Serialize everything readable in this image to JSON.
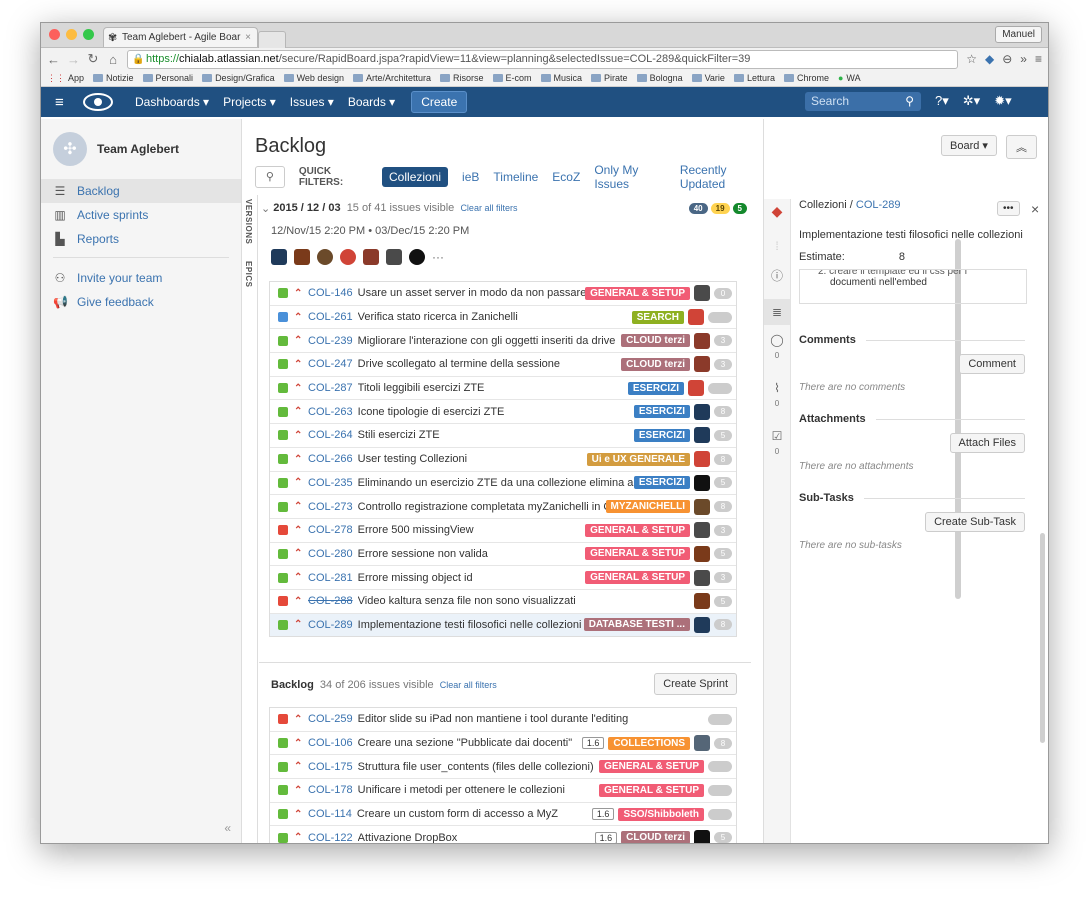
{
  "browser": {
    "tab_title": "Team Aglebert - Agile Boar",
    "user": "Manuel",
    "url_https": "https://",
    "url_host": "chialab.atlassian.net",
    "url_path": "/secure/RapidBoard.jspa?rapidView=11&view=planning&selectedIssue=COL-289&quickFilter=39",
    "bookmarks": [
      "App",
      "Notizie",
      "Personali",
      "Design/Grafica",
      "Web design",
      "Arte/Architettura",
      "Risorse",
      "E-com",
      "Musica",
      "Pirate",
      "Bologna",
      "Varie",
      "Lettura",
      "Chrome",
      "WA"
    ]
  },
  "nav": {
    "menu": [
      "Dashboards ▾",
      "Projects ▾",
      "Issues ▾",
      "Boards ▾"
    ],
    "create": "Create",
    "search_placeholder": "Search"
  },
  "sidebar": {
    "team": "Team Aglebert",
    "items": [
      "Backlog",
      "Active sprints",
      "Reports"
    ],
    "extra": [
      "Invite your team",
      "Give feedback"
    ]
  },
  "page": {
    "title": "Backlog",
    "board_btn": "Board ▾",
    "quick_label": "QUICK FILTERS:",
    "filters": [
      "Collezioni",
      "ieB",
      "Timeline",
      "EcoZ",
      "Only My Issues",
      "Recently Updated"
    ],
    "tab_versions": "VERSIONS",
    "tab_epics": "EPICS"
  },
  "sprint": {
    "name": "2015 / 12 / 03",
    "count": "15 of 41 issues visible",
    "clear": "Clear all filters",
    "badges": [
      "40",
      "19",
      "5"
    ],
    "dates": "12/Nov/15 2:20 PM • 03/Dec/15 2:20 PM",
    "more": "···",
    "issues": [
      {
        "type": "story",
        "key": "COL-146",
        "summary": "Usare un asset server in modo da non passare i co",
        "epic": "GENERAL & SETUP",
        "epic_color": "#f15c75",
        "est": "0",
        "av": "#4a4a4a"
      },
      {
        "type": "task",
        "key": "COL-261",
        "summary": "Verifica stato ricerca in Zanichelli",
        "epic": "SEARCH",
        "epic_color": "#8eb021",
        "est": "",
        "av": "#d04437"
      },
      {
        "type": "story",
        "key": "COL-239",
        "summary": "Migliorare l'interazione con gli oggetti inseriti da drive",
        "epic": "CLOUD terzi",
        "epic_color": "#ac707a",
        "est": "3",
        "av": "#8b3a2a"
      },
      {
        "type": "story",
        "key": "COL-247",
        "summary": "Drive scollegato al termine della sessione",
        "epic": "CLOUD terzi",
        "epic_color": "#ac707a",
        "est": "3",
        "av": "#8b3a2a"
      },
      {
        "type": "story",
        "key": "COL-287",
        "summary": "Titoli leggibili esercizi ZTE",
        "epic": "ESERCIZI",
        "epic_color": "#3b7fc4",
        "est": "",
        "av": "#d04437"
      },
      {
        "type": "story",
        "key": "COL-263",
        "summary": "Icone tipologie di esercizi ZTE",
        "epic": "ESERCIZI",
        "epic_color": "#3b7fc4",
        "est": "8",
        "av": "#1f3a5a"
      },
      {
        "type": "story",
        "key": "COL-264",
        "summary": "Stili esercizi ZTE",
        "epic": "ESERCIZI",
        "epic_color": "#3b7fc4",
        "est": "5",
        "av": "#1f3a5a"
      },
      {
        "type": "story",
        "key": "COL-266",
        "summary": "User testing Collezioni",
        "epic": "Ui e UX GENERALE",
        "epic_color": "#d39c3f",
        "est": "8",
        "av": "#d04437"
      },
      {
        "type": "story",
        "key": "COL-235",
        "summary": "Eliminando un esercizio ZTE da una collezione elimina altri 2 e",
        "epic": "ESERCIZI",
        "epic_color": "#3b7fc4",
        "est": "5",
        "av": "#111111"
      },
      {
        "type": "story",
        "key": "COL-273",
        "summary": "Controllo registrazione completata myZanichelli in Colle:",
        "epic": "MYZANICHELLI",
        "epic_color": "#f79232",
        "est": "8",
        "av": "#6b4a2a"
      },
      {
        "type": "bug",
        "key": "COL-278",
        "summary": "Errore 500 missingView",
        "epic": "GENERAL & SETUP",
        "epic_color": "#f15c75",
        "est": "3",
        "av": "#4a4a4a"
      },
      {
        "type": "story",
        "key": "COL-280",
        "summary": "Errore sessione non valida",
        "epic": "GENERAL & SETUP",
        "epic_color": "#f15c75",
        "est": "5",
        "av": "#7a3a1a"
      },
      {
        "type": "story",
        "key": "COL-281",
        "summary": "Errore missing object id",
        "epic": "GENERAL & SETUP",
        "epic_color": "#f15c75",
        "est": "3",
        "av": "#4a4a4a"
      },
      {
        "type": "bug",
        "key": "COL-288",
        "summary": "Video kaltura senza file non sono visualizzati",
        "epic": "",
        "epic_color": "",
        "est": "5",
        "av": "#7a3a1a",
        "strike": true
      },
      {
        "type": "story",
        "key": "COL-289",
        "summary": "Implementazione testi filosofici nelle collezioni",
        "epic": "DATABASE TESTI ...",
        "epic_color": "#ac707a",
        "est": "8",
        "av": "#1f3a5a",
        "selected": true
      }
    ]
  },
  "backlog": {
    "name": "Backlog",
    "count": "34 of 206 issues visible",
    "clear": "Clear all filters",
    "create_sprint": "Create Sprint",
    "issues": [
      {
        "type": "bug",
        "key": "COL-259",
        "summary": "Editor slide su iPad non mantiene i tool durante l'editing",
        "epic": "",
        "epic_color": "",
        "est": "",
        "lbl": ""
      },
      {
        "type": "story",
        "key": "COL-106",
        "summary": "Creare una sezione \"Pubblicate dai docenti\"",
        "epic": "COLLECTIONS",
        "epic_color": "#f79232",
        "est": "8",
        "lbl": "1.6",
        "av": "#556677"
      },
      {
        "type": "story",
        "key": "COL-175",
        "summary": "Struttura file user_contents (files delle collezioni)",
        "epic": "GENERAL & SETUP",
        "epic_color": "#f15c75",
        "est": "",
        "lbl": ""
      },
      {
        "type": "story",
        "key": "COL-178",
        "summary": "Unificare i metodi per ottenere le collezioni",
        "epic": "GENERAL & SETUP",
        "epic_color": "#f15c75",
        "est": "",
        "lbl": ""
      },
      {
        "type": "story",
        "key": "COL-114",
        "summary": "Creare un custom form di accesso a MyZ",
        "epic": "SSO/Shibboleth",
        "epic_color": "#f15c75",
        "est": "",
        "lbl": "1.6"
      },
      {
        "type": "story",
        "key": "COL-122",
        "summary": "Attivazione DropBox",
        "epic": "CLOUD terzi",
        "epic_color": "#ac707a",
        "est": "5",
        "lbl": "1.6",
        "av": "#111111"
      }
    ]
  },
  "detail": {
    "project": "Collezioni",
    "key": "COL-289",
    "more": "•••",
    "summary": "Implementazione testi filosofici nelle collezioni",
    "estimate_label": "Estimate:",
    "estimate": "8",
    "desc_line1": "2. creare il template ed il css per i",
    "desc_line2": "documenti nell'embed",
    "comments": "Comments",
    "comment_btn": "Comment",
    "no_comments": "There are no comments",
    "attachments": "Attachments",
    "attach_btn": "Attach Files",
    "no_attachments": "There are no attachments",
    "subtasks": "Sub-Tasks",
    "subtask_btn": "Create Sub-Task",
    "no_subtasks": "There are no sub-tasks",
    "rail_counts": [
      "0",
      "0",
      "0"
    ]
  }
}
